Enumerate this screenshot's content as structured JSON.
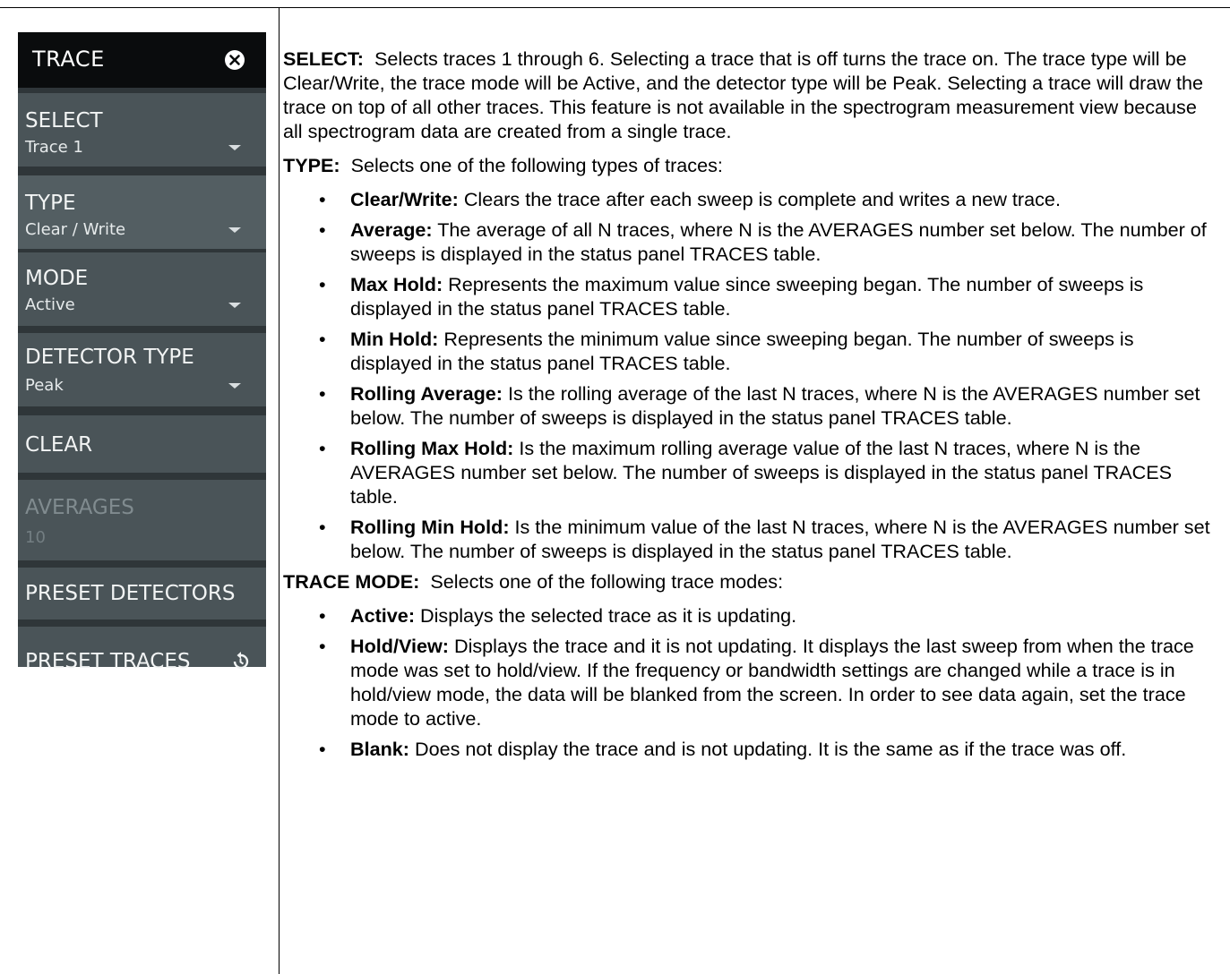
{
  "menu": {
    "title": "TRACE",
    "items": [
      {
        "label": "SELECT",
        "value": "Trace 1"
      },
      {
        "label": "TYPE",
        "value": "Clear / Write"
      },
      {
        "label": "MODE",
        "value": "Active"
      },
      {
        "label": "DETECTOR TYPE",
        "value": "Peak"
      },
      {
        "label": "CLEAR"
      },
      {
        "label": "AVERAGES",
        "value": "10"
      },
      {
        "label": "PRESET DETECTORS"
      },
      {
        "label": "PRESET TRACES"
      }
    ]
  },
  "doc": {
    "select": {
      "term": "SELECT:",
      "text": "Selects traces 1 through 6. Selecting a trace that is off turns the trace on. The trace type will be Clear/Write, the trace mode will be Active, and the detector type will be Peak. Selecting a trace will draw the trace on top of all other traces. This feature is not available in the spectrogram measurement view because all spectrogram data are created from a single trace."
    },
    "type": {
      "term": "TYPE:",
      "text": "Selects one of the following types of traces:",
      "bullets": [
        {
          "term": "Clear/Write:",
          "text": "Clears the trace after each sweep is complete and writes a new trace."
        },
        {
          "term": "Average:",
          "text": "The average of all N traces, where N is the AVERAGES number set below. The number of sweeps is displayed in the status panel TRACES table."
        },
        {
          "term": "Max Hold:",
          "text": "Represents the maximum value since sweeping began. The number of sweeps is displayed in the status panel TRACES table."
        },
        {
          "term": "Min Hold:",
          "text": "Represents the minimum value since sweeping began. The number of sweeps is displayed in the status panel TRACES table."
        },
        {
          "term": "Rolling Average:",
          "text": "Is the rolling average of the last N traces, where N is the AVERAGES number set below. The number of sweeps is displayed in the status panel TRACES table."
        },
        {
          "term": "Rolling Max Hold:",
          "text": "Is the maximum rolling average value of the last N traces, where N is the AVERAGES number set below. The number of sweeps is displayed in the status panel TRACES table."
        },
        {
          "term": "Rolling Min Hold:",
          "text": "Is the minimum value of the last N traces, where N is the AVERAGES number set below. The number of sweeps is displayed in the status panel TRACES table."
        }
      ]
    },
    "mode": {
      "term": "TRACE MODE:",
      "text": "Selects one of the following trace modes:",
      "bullets": [
        {
          "term": "Active:",
          "text": "Displays the selected trace as it is updating."
        },
        {
          "term": "Hold/View:",
          "text": "Displays the trace and it is not updating. It displays the last sweep from when the trace mode was set to hold/view. If the frequency or bandwidth settings are changed while a trace is in hold/view mode, the data will be blanked from the screen. In order to see data again, set the trace mode to active."
        },
        {
          "term": "Blank:",
          "text": "Does not display the trace and is not updating. It is the same as if the trace was off."
        }
      ]
    }
  }
}
